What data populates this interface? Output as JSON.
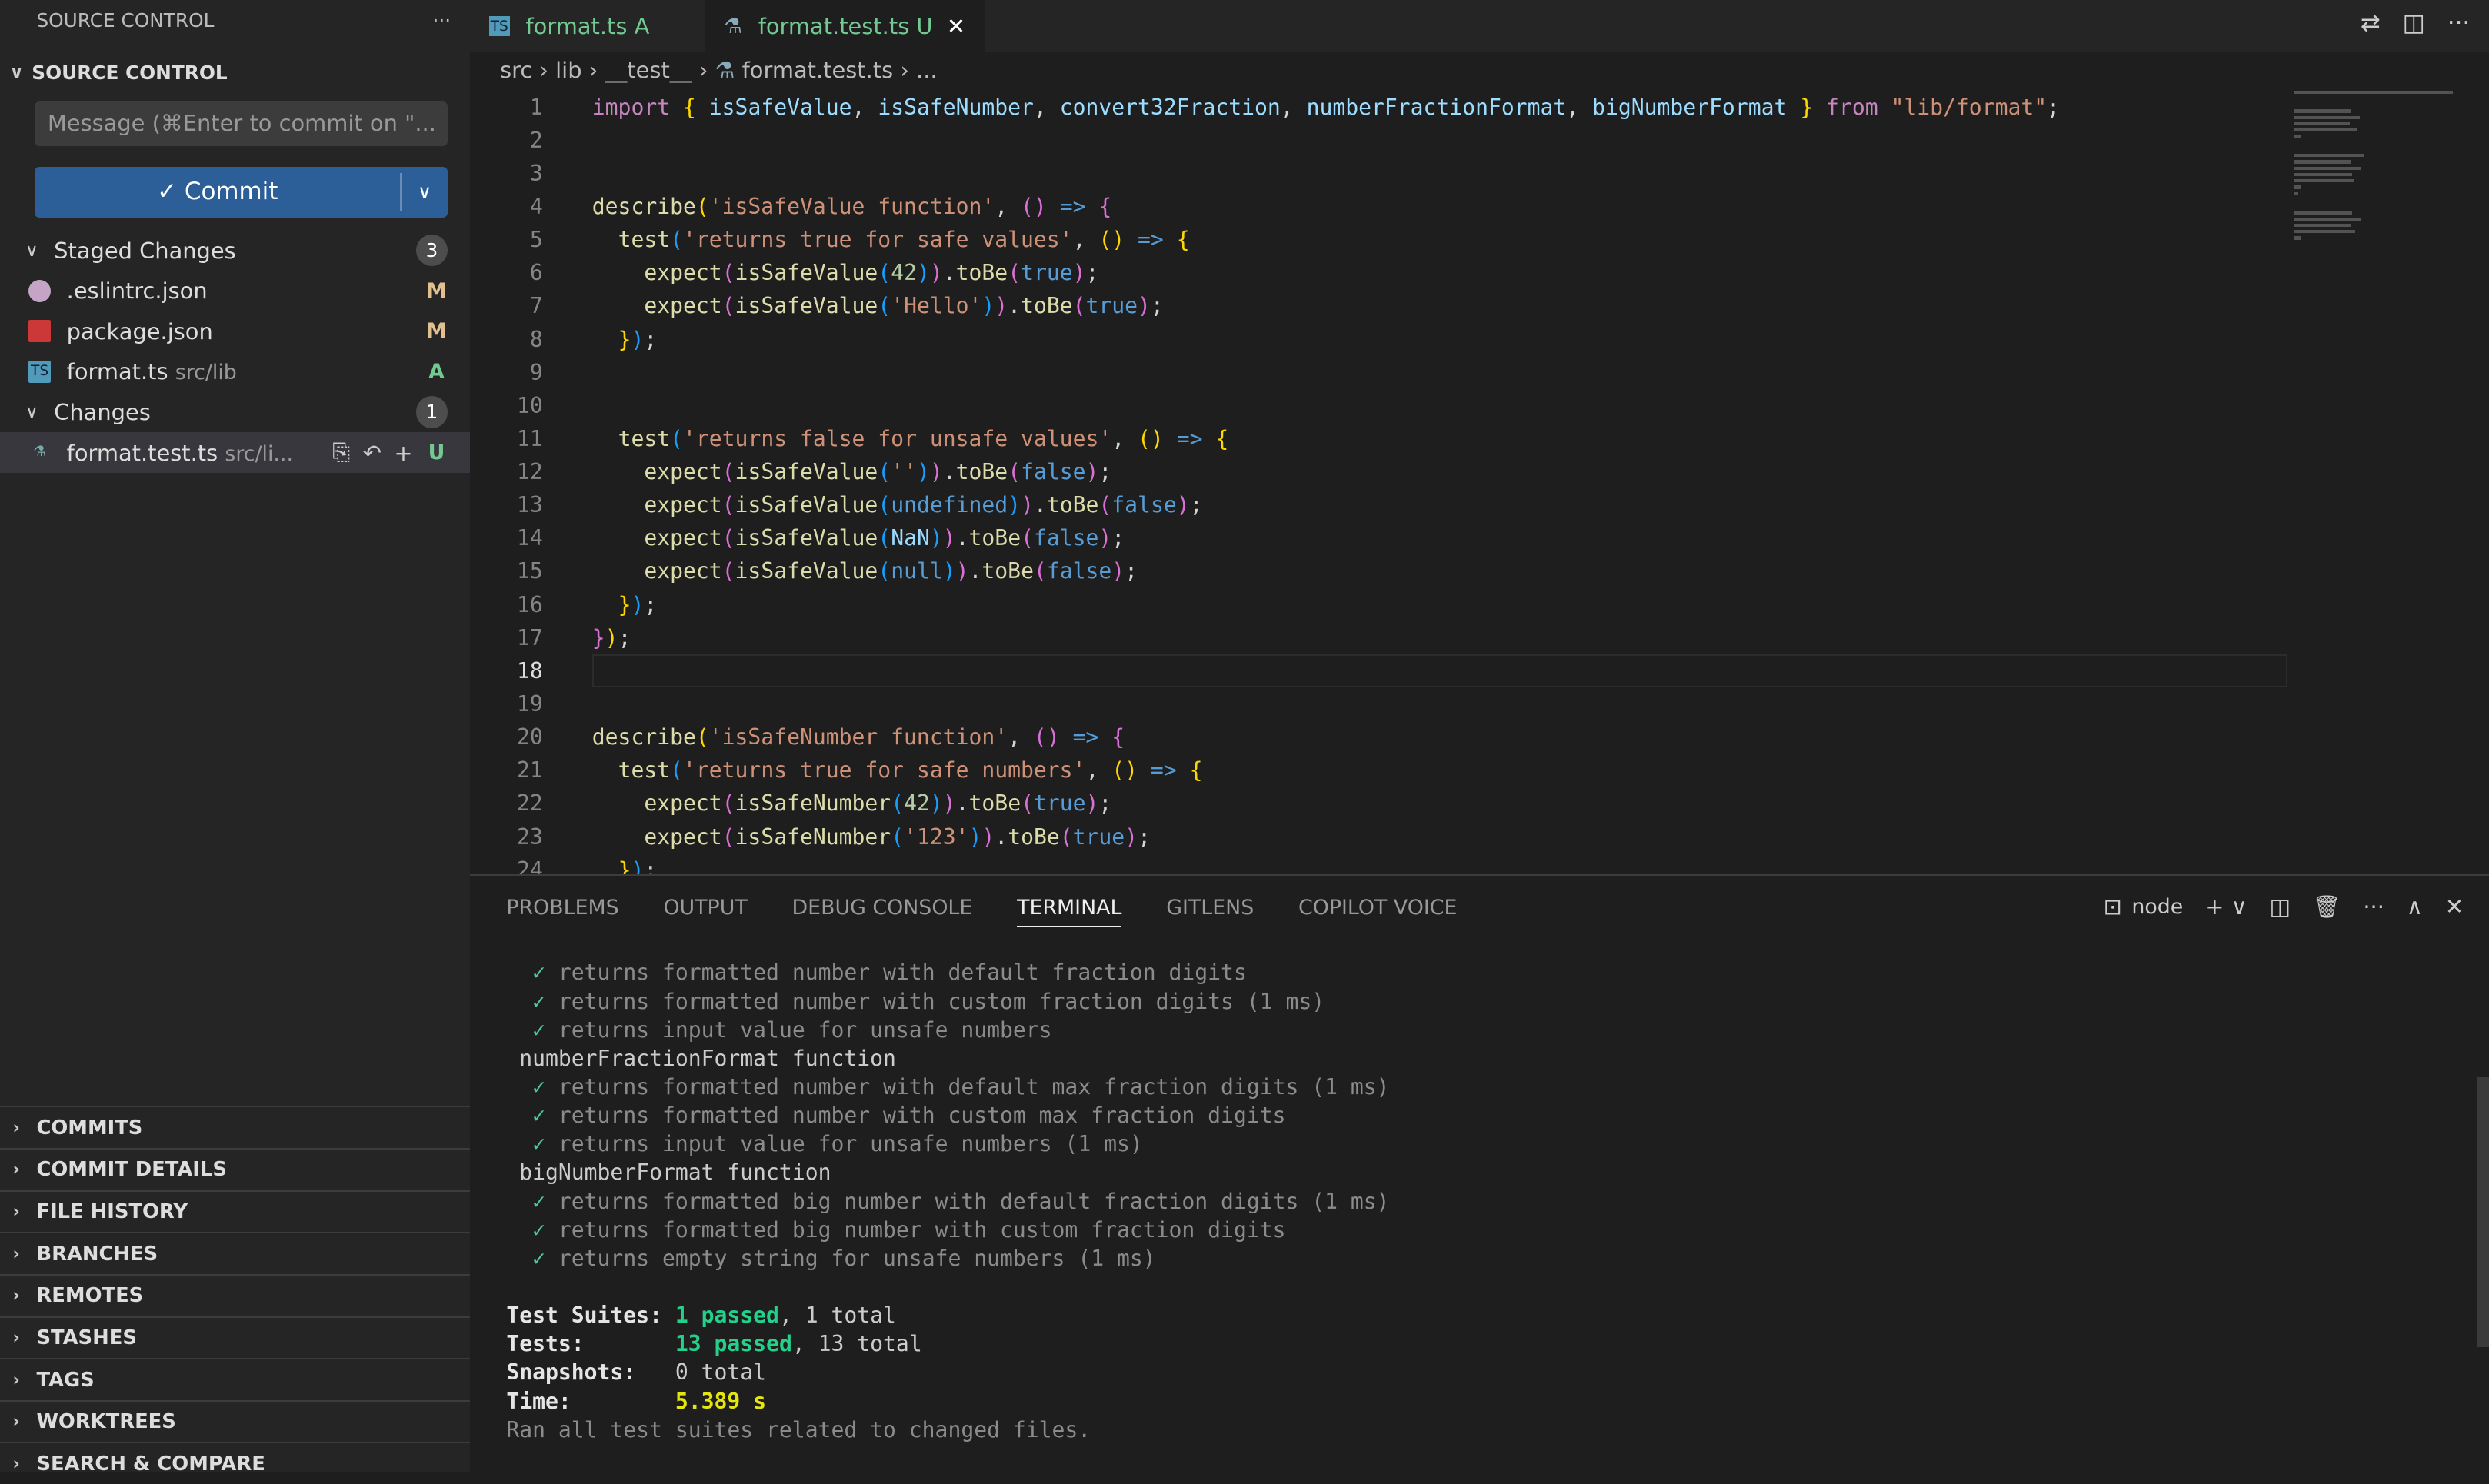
{
  "sidebar": {
    "header": "SOURCE CONTROL",
    "more": "···",
    "section": "SOURCE CONTROL",
    "message_placeholder": "Message (⌘Enter to commit on \"...",
    "commit_label": "✓ Commit",
    "staged": {
      "label": "Staged Changes",
      "count": "3",
      "files": [
        {
          "name": ".eslintrc.json",
          "path": "",
          "status": "M",
          "icon": "eslint-icon",
          "color": "#c5a5c5",
          "status_color": "#e2c08d"
        },
        {
          "name": "package.json",
          "path": "",
          "status": "M",
          "icon": "npm-icon",
          "color": "#cb3837",
          "status_color": "#e2c08d"
        },
        {
          "name": "format.ts",
          "path": "src/lib",
          "status": "A",
          "icon": "typescript-icon",
          "color": "#519aba",
          "status_color": "#73c991"
        }
      ]
    },
    "changes": {
      "label": "Changes",
      "count": "1",
      "files": [
        {
          "name": "format.test.ts",
          "path": "src/li...",
          "status": "U",
          "icon": "test-flask-icon",
          "status_color": "#73c991"
        }
      ]
    },
    "sections": [
      "COMMITS",
      "COMMIT DETAILS",
      "FILE HISTORY",
      "BRANCHES",
      "REMOTES",
      "STASHES",
      "TAGS",
      "WORKTREES",
      "SEARCH & COMPARE"
    ]
  },
  "tabs": [
    {
      "name": "format.ts",
      "status": "A",
      "icon": "TS",
      "active": false
    },
    {
      "name": "format.test.ts",
      "status": "U",
      "icon": "⚗",
      "active": true,
      "close": "✕"
    }
  ],
  "breadcrumb": [
    "src",
    "lib",
    "__test__",
    "format.test.ts",
    "..."
  ],
  "editor": {
    "current_line": 18,
    "lines": [
      "import { isSafeValue, isSafeNumber, convert32Fraction, numberFractionFormat, bigNumberFormat } from \"lib/format\";",
      "",
      "",
      "describe('isSafeValue function', () => {",
      "  test('returns true for safe values', () => {",
      "    expect(isSafeValue(42)).toBe(true);",
      "    expect(isSafeValue('Hello')).toBe(true);",
      "  });",
      "",
      "",
      "  test('returns false for unsafe values', () => {",
      "    expect(isSafeValue('')).toBe(false);",
      "    expect(isSafeValue(undefined)).toBe(false);",
      "    expect(isSafeValue(NaN)).toBe(false);",
      "    expect(isSafeValue(null)).toBe(false);",
      "  });",
      "});",
      "",
      "",
      "describe('isSafeNumber function', () => {",
      "  test('returns true for safe numbers', () => {",
      "    expect(isSafeNumber(42)).toBe(true);",
      "    expect(isSafeNumber('123')).toBe(true);",
      "  });"
    ]
  },
  "panel": {
    "tabs": [
      "PROBLEMS",
      "OUTPUT",
      "DEBUG CONSOLE",
      "TERMINAL",
      "GITLENS",
      "COPILOT VOICE"
    ],
    "active": "TERMINAL",
    "shell": "node"
  },
  "terminal": {
    "lines": [
      {
        "t": "check",
        "text": "returns formatted number with default fraction digits"
      },
      {
        "t": "check",
        "text": "returns formatted number with custom fraction digits (1 ms)"
      },
      {
        "t": "check",
        "text": "returns input value for unsafe numbers"
      },
      {
        "t": "group",
        "text": "numberFractionFormat function"
      },
      {
        "t": "check",
        "text": "returns formatted number with default max fraction digits (1 ms)"
      },
      {
        "t": "check",
        "text": "returns formatted number with custom max fraction digits"
      },
      {
        "t": "check",
        "text": "returns input value for unsafe numbers (1 ms)"
      },
      {
        "t": "group",
        "text": "bigNumberFormat function"
      },
      {
        "t": "check",
        "text": "returns formatted big number with default fraction digits (1 ms)"
      },
      {
        "t": "check",
        "text": "returns formatted big number with custom fraction digits"
      },
      {
        "t": "check",
        "text": "returns empty string for unsafe numbers (1 ms)"
      }
    ],
    "summary": {
      "suites_label": "Test Suites:",
      "suites_passed": "1 passed",
      "suites_total": ", 1 total",
      "tests_label": "Tests:",
      "tests_passed": "13 passed",
      "tests_total": ", 13 total",
      "snap_label": "Snapshots:",
      "snap_value": "0 total",
      "time_label": "Time:",
      "time_value": "5.389 s",
      "footer": "Ran all test suites related to changed files."
    }
  }
}
